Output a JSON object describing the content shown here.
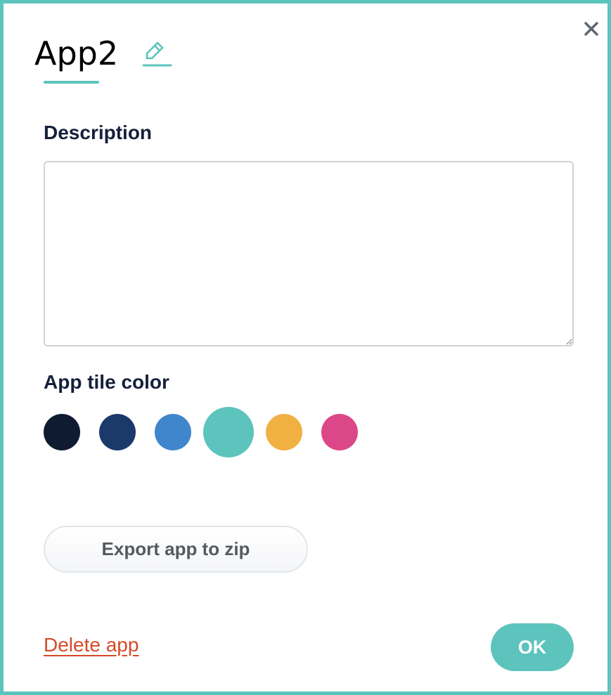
{
  "dialog": {
    "app_name": "App2",
    "close_icon": "close-icon",
    "edit_icon": "pencil-icon"
  },
  "description": {
    "label": "Description",
    "value": "",
    "placeholder": ""
  },
  "tile_color": {
    "label": "App tile color",
    "swatches": [
      {
        "name": "navy-black",
        "color": "#0f1b30",
        "selected": false
      },
      {
        "name": "dark-blue",
        "color": "#1b3a6c",
        "selected": false
      },
      {
        "name": "blue",
        "color": "#3f86cc",
        "selected": false
      },
      {
        "name": "teal",
        "color": "#5cc4bc",
        "selected": true
      },
      {
        "name": "yellow",
        "color": "#f0b142",
        "selected": false
      },
      {
        "name": "pink",
        "color": "#dc4787",
        "selected": false
      }
    ]
  },
  "actions": {
    "export_label": "Export app to zip",
    "delete_label": "Delete app",
    "ok_label": "OK"
  },
  "colors": {
    "accent": "#5cc4bc",
    "danger": "#d54a2a",
    "text": "#15203a"
  }
}
